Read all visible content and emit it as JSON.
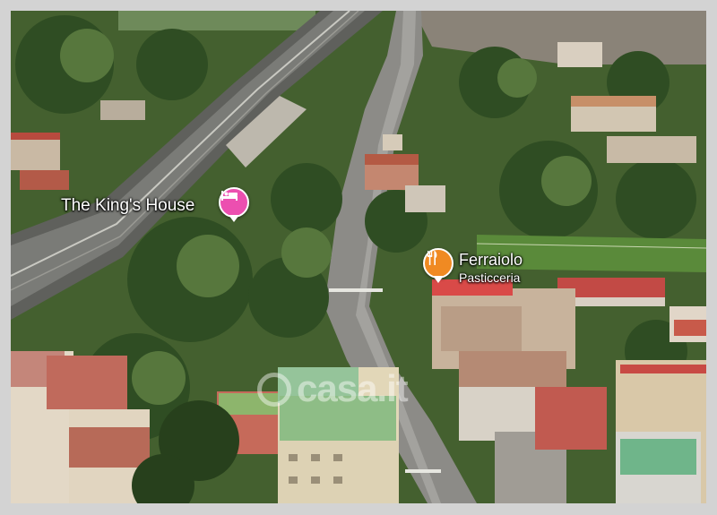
{
  "places": [
    {
      "name": "The King's House",
      "category": "",
      "icon": "hotel-bed-icon",
      "color": "#ec4fb0"
    },
    {
      "name": "Ferraiolo",
      "category": "Pasticceria",
      "icon": "fork-knife-icon",
      "color": "#f08a22"
    }
  ],
  "watermark": {
    "text": "casa.it",
    "icon": "casa-logo-icon"
  }
}
